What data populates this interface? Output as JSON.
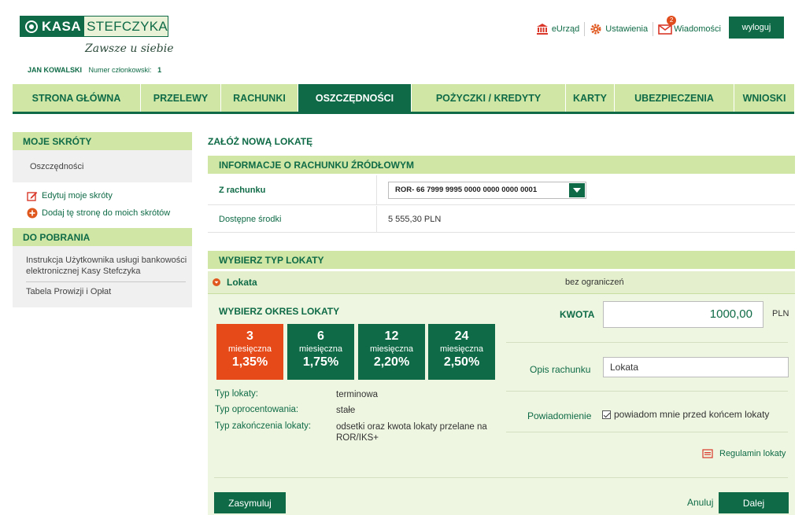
{
  "brand": {
    "logo_left": "KASA",
    "logo_right": "STEFCZYKA",
    "tagline": "Zawsze u siebie"
  },
  "user": {
    "name": "JAN KOWALSKI",
    "member_label": "Numer członkowski:",
    "member_number": "1"
  },
  "top_links": {
    "eurzad": "eUrząd",
    "settings": "Ustawienia",
    "messages": "Wiadomości",
    "messages_badge": "2",
    "logout": "wyloguj"
  },
  "nav": [
    {
      "label": "STRONA GŁÓWNA",
      "active": false
    },
    {
      "label": "PRZELEWY",
      "active": false
    },
    {
      "label": "RACHUNKI",
      "active": false
    },
    {
      "label": "OSZCZĘDNOŚCI",
      "active": true
    },
    {
      "label": "POŻYCZKI / KREDYTY",
      "active": false
    },
    {
      "label": "KARTY",
      "active": false
    },
    {
      "label": "UBEZPIECZENIA",
      "active": false
    },
    {
      "label": "WNIOSKI",
      "active": false
    }
  ],
  "sidebar": {
    "shortcuts_title": "MOJE SKRÓTY",
    "shortcut_item": "Oszczędności",
    "edit_link": "Edytuj moje skróty",
    "add_link": "Dodaj tę stronę do moich skrótów",
    "downloads_title": "DO POBRANIA",
    "downloads": [
      "Instrukcja Użytkownika usługi bankowości elektronicznej Kasy Stefczyka",
      "Tabela Prowizji i Opłat"
    ]
  },
  "main": {
    "title": "ZAŁÓŻ NOWĄ LOKATĘ",
    "source_section": "INFORMACJE O RACHUNKU ŹRÓDŁOWYM",
    "from_account_label": "Z rachunku",
    "from_account_value": "ROR- 66 7999 9995 0000 0000 0000 0001",
    "available_label": "Dostępne środki",
    "available_value": "5 555,30 PLN",
    "type_section": "WYBIERZ TYP LOKATY",
    "lokata_name": "Lokata",
    "lokata_desc": "bez ograniczeń",
    "period_title": "WYBIERZ OKRES LOKATY",
    "periods": [
      {
        "months": "3",
        "unit": "miesięczna",
        "rate": "1,35%",
        "active": true
      },
      {
        "months": "6",
        "unit": "miesięczna",
        "rate": "1,75%",
        "active": false
      },
      {
        "months": "12",
        "unit": "miesięczna",
        "rate": "2,20%",
        "active": false
      },
      {
        "months": "24",
        "unit": "miesięczna",
        "rate": "2,50%",
        "active": false
      }
    ],
    "details": [
      {
        "key": "Typ lokaty:",
        "value": "terminowa"
      },
      {
        "key": "Typ oprocentowania:",
        "value": "stałe"
      },
      {
        "key": "Typ zakończenia lokaty:",
        "value": "odsetki oraz kwota lokaty przelane na ROR/IKS+"
      }
    ],
    "amount_label": "KWOTA",
    "amount_value": "1000,00",
    "currency": "PLN",
    "description_label": "Opis rachunku",
    "description_value": "Lokata",
    "notification_label": "Powiadomienie",
    "notification_checkbox": "powiadom mnie przed końcem lokaty",
    "terms_link": "Regulamin lokaty",
    "simulate_button": "Zasymuluj",
    "cancel_button": "Anuluj",
    "next_button": "Dalej"
  },
  "colors": {
    "brand_green": "#0f6b47",
    "light_green": "#cfe6a5",
    "active_tile": "#e64a19"
  }
}
